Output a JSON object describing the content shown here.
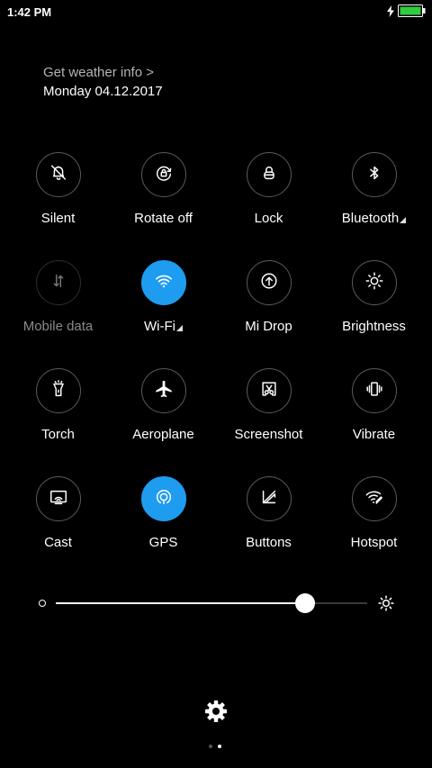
{
  "status_bar": {
    "time": "1:42 PM",
    "battery_level": 1.0,
    "charging": true,
    "battery_color": "#2ecc40"
  },
  "header": {
    "weather_link": "Get weather info >",
    "date": "Monday 04.12.2017"
  },
  "toggles": [
    {
      "label": "Silent",
      "icon": "bell-off-icon",
      "state": "off"
    },
    {
      "label": "Rotate off",
      "icon": "rotation-lock-icon",
      "state": "off"
    },
    {
      "label": "Lock",
      "icon": "lock-icon",
      "state": "off"
    },
    {
      "label": "Bluetooth",
      "icon": "bluetooth-icon",
      "state": "off",
      "expandable": true
    },
    {
      "label": "Mobile data",
      "icon": "mobile-data-icon",
      "state": "disabled"
    },
    {
      "label": "Wi-Fi",
      "icon": "wifi-icon",
      "state": "on",
      "expandable": true
    },
    {
      "label": "Mi Drop",
      "icon": "mi-drop-icon",
      "state": "off"
    },
    {
      "label": "Brightness",
      "icon": "sun-icon",
      "state": "off"
    },
    {
      "label": "Torch",
      "icon": "flashlight-icon",
      "state": "off"
    },
    {
      "label": "Aeroplane",
      "icon": "airplane-icon",
      "state": "off"
    },
    {
      "label": "Screenshot",
      "icon": "scissors-icon",
      "state": "off"
    },
    {
      "label": "Vibrate",
      "icon": "vibrate-icon",
      "state": "off"
    },
    {
      "label": "Cast",
      "icon": "cast-icon",
      "state": "off"
    },
    {
      "label": "GPS",
      "icon": "location-icon",
      "state": "on"
    },
    {
      "label": "Buttons",
      "icon": "buttons-icon",
      "state": "off"
    },
    {
      "label": "Hotspot",
      "icon": "hotspot-icon",
      "state": "off"
    }
  ],
  "brightness": {
    "level": 0.8
  },
  "footer": {
    "settings_icon": "gear-icon",
    "page_count": 2,
    "active_page": 2
  },
  "colors": {
    "accent": "#1e9cf0",
    "background": "#000000"
  }
}
